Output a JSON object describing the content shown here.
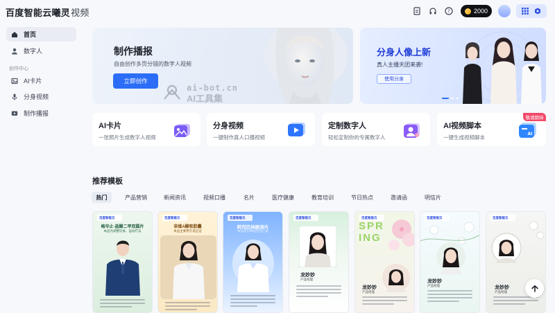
{
  "header": {
    "logo_main": "百度智能云曦灵",
    "logo_sub": "视频",
    "coins": "2000",
    "icons": [
      "document-icon",
      "headset-icon",
      "help-icon"
    ]
  },
  "sidebar": {
    "items": [
      {
        "label": "首页",
        "icon": "home-icon",
        "active": true
      },
      {
        "label": "数字人",
        "icon": "person-icon",
        "active": false
      }
    ],
    "group_label": "创作中心",
    "group_items": [
      {
        "label": "AI卡片",
        "icon": "ai-card-icon"
      },
      {
        "label": "分身视频",
        "icon": "microphone-icon"
      },
      {
        "label": "制作播报",
        "icon": "broadcast-icon"
      }
    ]
  },
  "banner_main": {
    "title": "制作播报",
    "subtitle": "自由创作多页分镜的数字人视频",
    "button": "立即创作",
    "watermark_top": "ai-bot.cn",
    "watermark_bottom": "AI工具集"
  },
  "banner_side": {
    "title": "分身人像上新",
    "subtitle": "真人主播天团来袭!",
    "button": "使用分身"
  },
  "features": [
    {
      "title": "AI卡片",
      "desc": "一张照片生成数字人视频",
      "icon": "image-card-icon"
    },
    {
      "title": "分身视频",
      "desc": "一键制作真人口播视频",
      "icon": "play-video-icon"
    },
    {
      "title": "定制数字人",
      "desc": "轻松定制你的专属数字人",
      "icon": "custom-avatar-icon"
    },
    {
      "title": "AI视频脚本",
      "desc": "一键生成视频脚本",
      "icon": "ai-script-icon"
    }
  ],
  "badge_soon": "敬请期待",
  "templates": {
    "title": "推荐模板",
    "tabs": [
      "热门",
      "产品营销",
      "新闻资讯",
      "视频口播",
      "名片",
      "医疗健康",
      "教育培训",
      "节日热点",
      "邀请函",
      "明信片"
    ],
    "cards": [
      {
        "chip": "百度智能云",
        "title": "格华止·盐酸二甲双胍片",
        "subtitle": "本品为调整饮食、运动疗法"
      },
      {
        "chip": "百度智能云",
        "title": "非维A酸软胶囊",
        "subtitle": "本品主要用于适应证"
      },
      {
        "chip": "百度智能云",
        "title": "阿司匹林肠溶片",
        "subtitle": "本品用于降低急性心肌"
      },
      {
        "chip": "百度智能云",
        "name": "龙妙妙",
        "role": "产品经理"
      },
      {
        "chip": "百度智能云",
        "spring": "SPRING",
        "name": "龙妙妙",
        "role": "产品经理"
      },
      {
        "chip": "百度智能云",
        "name": "龙妙妙",
        "role": "产品经理"
      },
      {
        "chip": "百度智能云",
        "name": "龙妙妙",
        "role": "产品经理"
      }
    ]
  }
}
